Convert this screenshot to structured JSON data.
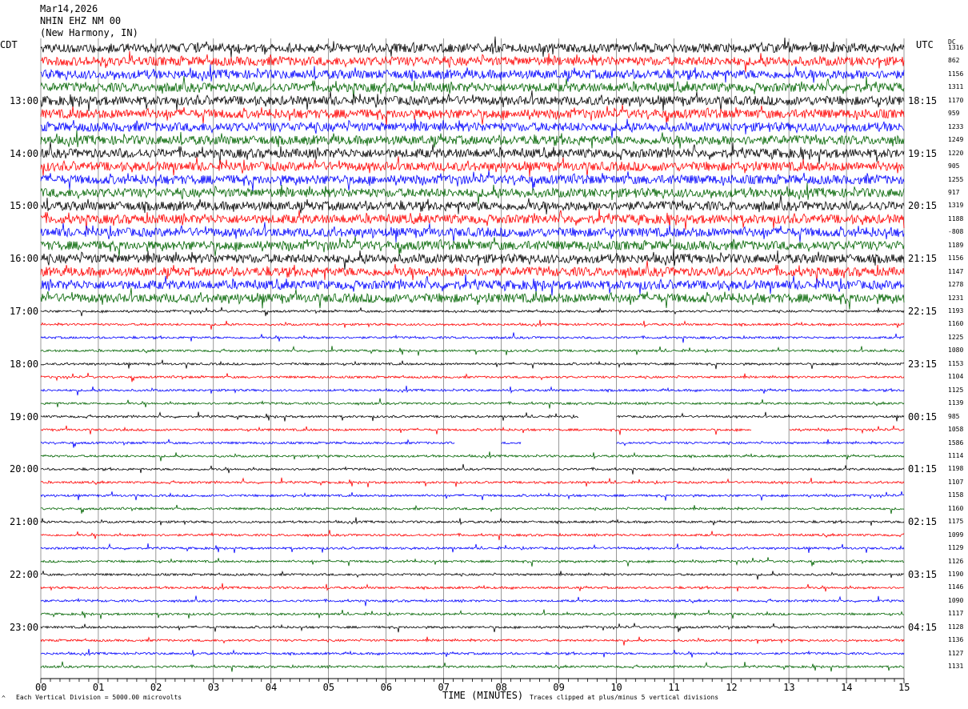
{
  "header": {
    "date": "Mar14,2026",
    "station": "NHIN EHZ NM 00",
    "location": "(New Harmony, IN)"
  },
  "left_tz": "CDT",
  "right_tz": "UTC",
  "dc_header": "DC",
  "footer": {
    "scale_note": "Each Vertical Division = 5000.00 microvolts",
    "xlabel": "TIME (MINUTES)",
    "clip_note": "Traces clipped at plus/minus 5 vertical divisions"
  },
  "colors": {
    "trace_cycle": [
      "#000000",
      "#ff0000",
      "#0000ff",
      "#006400"
    ],
    "grid": "#555555"
  },
  "chart_data": {
    "type": "helicorder",
    "x_ticks": [
      "00",
      "01",
      "02",
      "03",
      "04",
      "05",
      "06",
      "07",
      "08",
      "09",
      "10",
      "11",
      "12",
      "13",
      "14",
      "15"
    ],
    "xlim": [
      0,
      15
    ],
    "rows_per_hour": 4,
    "left_time_labels": [
      "13:00",
      "14:00",
      "15:00",
      "16:00",
      "17:00",
      "18:00",
      "19:00",
      "20:00",
      "21:00",
      "22:00",
      "23:00"
    ],
    "right_time_labels": [
      "18:15",
      "19:15",
      "20:15",
      "21:15",
      "22:15",
      "23:15",
      "00:15",
      "01:15",
      "02:15",
      "03:15",
      "04:15"
    ],
    "dc_values": [
      "1316",
      "862",
      "1156",
      "1311",
      "1170",
      "959",
      "1233",
      "1249",
      "1220",
      "905",
      "1255",
      "917",
      "1319",
      "1188",
      "-808",
      "1189",
      "1156",
      "1147",
      "1278",
      "1231",
      "1193",
      "1160",
      "1225",
      "1080",
      "1153",
      "1104",
      "1125",
      "1139",
      "985",
      "1058",
      "1586",
      "1114",
      "1198",
      "1107",
      "1158",
      "1160",
      "1175",
      "1099",
      "1129",
      "1126",
      "1190",
      "1146",
      "1090",
      "1117",
      "1128",
      "1136",
      "1127",
      "1131"
    ],
    "row_noise_level": [
      "high",
      "high",
      "high",
      "high",
      "high",
      "high",
      "high",
      "high",
      "high",
      "high",
      "high",
      "high",
      "high",
      "high",
      "high",
      "high",
      "high",
      "high",
      "high",
      "high",
      "low",
      "low",
      "low",
      "low",
      "low",
      "low",
      "low",
      "low",
      "low",
      "low",
      "low",
      "low",
      "low",
      "low",
      "low",
      "low",
      "low",
      "low",
      "low",
      "low",
      "low",
      "low",
      "low",
      "low",
      "low",
      "low",
      "low",
      "low"
    ],
    "data_gaps": [
      {
        "row": 28,
        "from_min": 9.35,
        "to_min": 10.0
      },
      {
        "row": 29,
        "from_min": 12.35,
        "to_min": 13.0
      },
      {
        "row": 30,
        "from_min": 7.2,
        "to_min": 8.0
      },
      {
        "row": 30,
        "from_min": 8.35,
        "to_min": 10.0
      }
    ]
  }
}
